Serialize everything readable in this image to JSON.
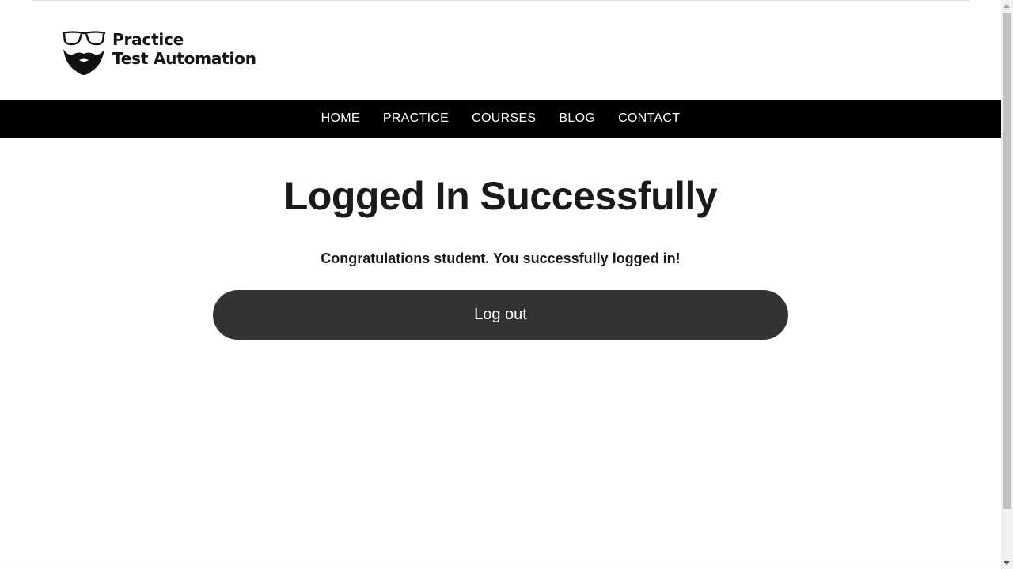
{
  "header": {
    "logo": {
      "line1": "Practice",
      "line2": "Test Automation",
      "icon": "bearded-face-glasses-icon"
    }
  },
  "nav": {
    "items": [
      {
        "label": "HOME"
      },
      {
        "label": "PRACTICE"
      },
      {
        "label": "COURSES"
      },
      {
        "label": "BLOG"
      },
      {
        "label": "CONTACT"
      }
    ]
  },
  "main": {
    "title": "Logged In Successfully",
    "message": "Congratulations student. You successfully logged in!",
    "logout_label": "Log out"
  },
  "colors": {
    "nav_background": "#000000",
    "nav_text": "#ffffff",
    "button_background": "#333333",
    "button_text": "#ffffff",
    "title_text": "#1a1a1a"
  }
}
